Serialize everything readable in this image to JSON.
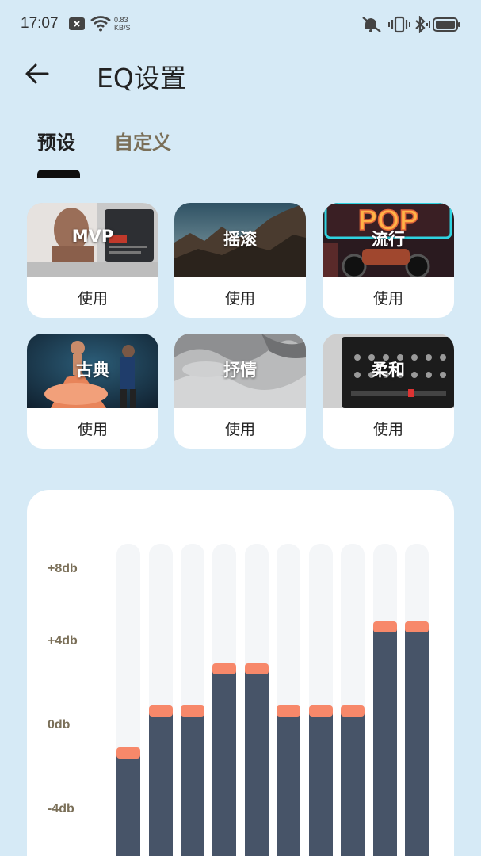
{
  "status_bar": {
    "time": "17:07",
    "net_speed_value": "0.83",
    "net_speed_unit": "KB/S",
    "icons": [
      "notification-box-icon",
      "wifi-icon",
      "mute-icon",
      "vibrate-icon",
      "bluetooth-icon",
      "battery-icon"
    ]
  },
  "header": {
    "title": "EQ设置"
  },
  "tabs": [
    {
      "label": "预设",
      "active": true
    },
    {
      "label": "自定义",
      "active": false
    }
  ],
  "presets": [
    {
      "name": "MVP",
      "action": "使用"
    },
    {
      "name": "摇滚",
      "action": "使用"
    },
    {
      "name": "流行",
      "action": "使用"
    },
    {
      "name": "古典",
      "action": "使用"
    },
    {
      "name": "抒情",
      "action": "使用"
    },
    {
      "name": "柔和",
      "action": "使用"
    }
  ],
  "poster_text": {
    "pop": "POP"
  },
  "eq": {
    "db_labels": [
      "+8db",
      "+4db",
      "0db",
      "-4db"
    ],
    "band_levels_db": [
      -2,
      0,
      0,
      2,
      2,
      0,
      0,
      0,
      4,
      4
    ],
    "colors": {
      "fill": "#475468",
      "cap": "#f7886a",
      "track": "#f4f6f8"
    }
  }
}
